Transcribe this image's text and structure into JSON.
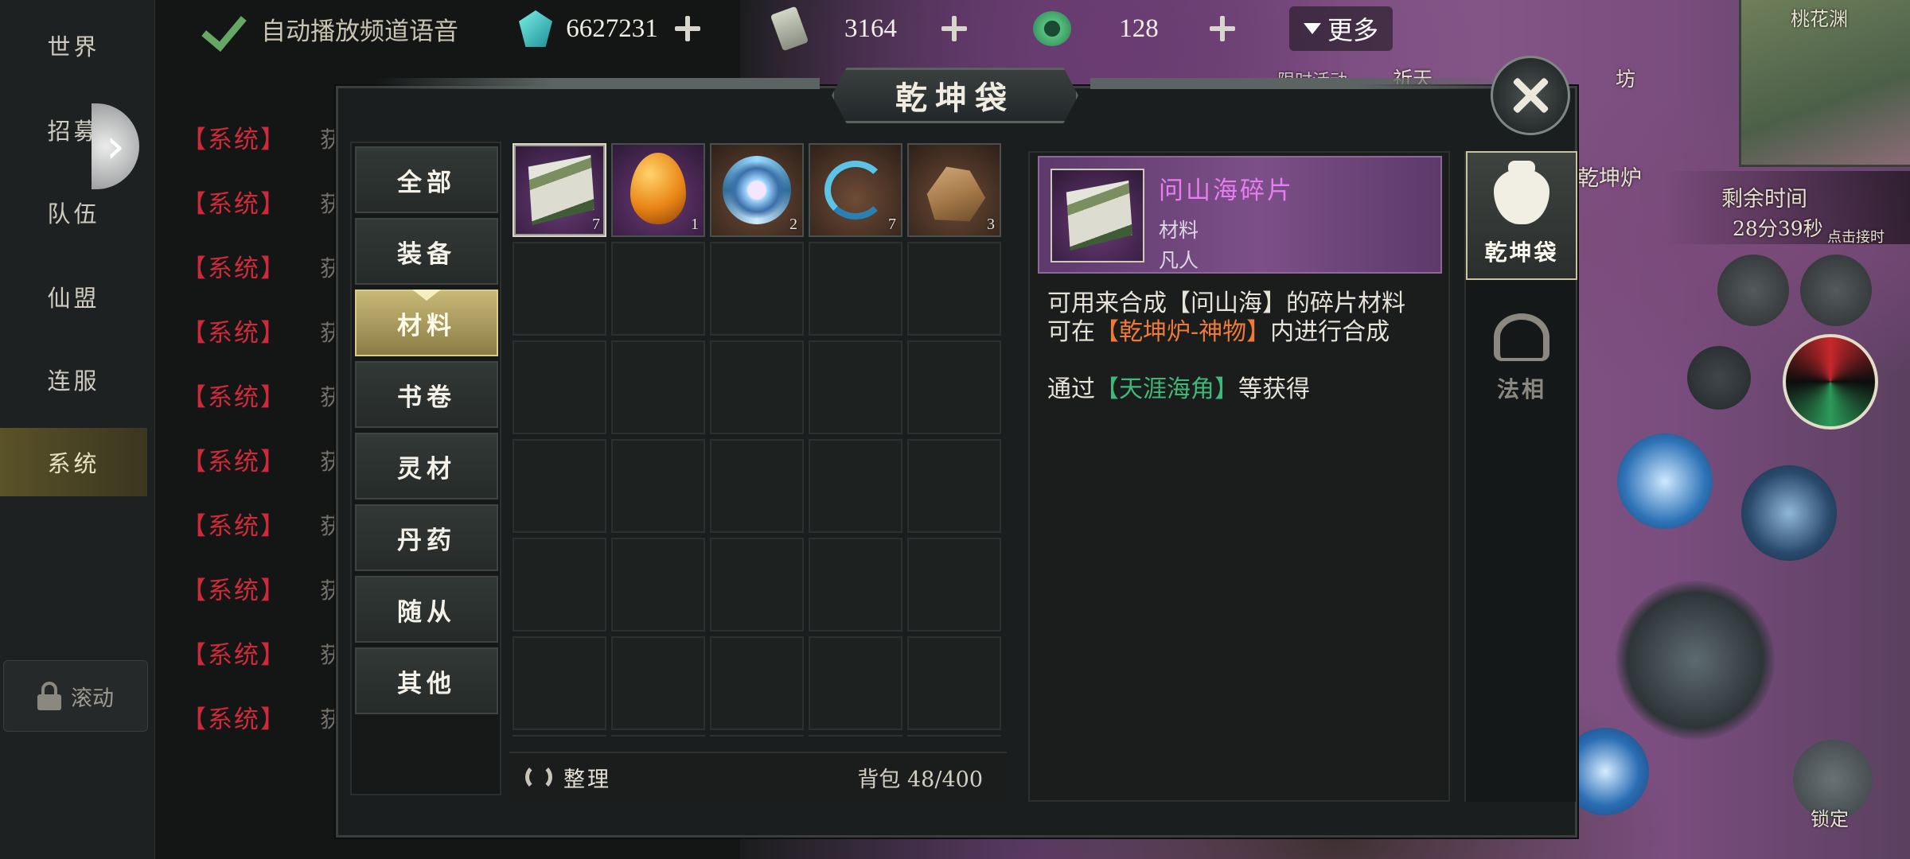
{
  "channels": {
    "tabs": [
      "世界",
      "招募",
      "队伍",
      "仙盟",
      "连服",
      "系统"
    ],
    "active": "系统",
    "scroll_lock_label": "滚动",
    "system_tag": "【系统】",
    "system_tag_count": 10,
    "message_prefix": "获"
  },
  "topbar": {
    "autoplay_label": "自动播放频道语音",
    "currencies": [
      {
        "icon": "spirit-stone-icon",
        "value": "6627231"
      },
      {
        "icon": "scroll-token-icon",
        "value": "3164"
      },
      {
        "icon": "jade-icon",
        "value": "128"
      }
    ],
    "more_label": "更多"
  },
  "hud": {
    "map_name": "桃花渊",
    "event_label": "限时活动",
    "pray_label": "祈天",
    "shop_label": "坊",
    "furnace_label": "乾坤炉",
    "remaining_time_label": "剩余时间",
    "remaining_time_value": "28分39秒",
    "click_hint": "点击接时",
    "lock_label": "锁定"
  },
  "bag": {
    "title": "乾坤袋",
    "categories": [
      "全部",
      "装备",
      "材料",
      "书卷",
      "灵材",
      "丹药",
      "随从",
      "其他"
    ],
    "active_category": "材料",
    "items": [
      {
        "name": "问山海碎片",
        "icon": "scroll-fragment-icon",
        "count": "7",
        "quality": "purple",
        "selected": true
      },
      {
        "name": "",
        "icon": "amber-egg-icon",
        "count": "1",
        "quality": "purple",
        "selected": false
      },
      {
        "name": "",
        "icon": "spirit-orb-icon",
        "count": "2",
        "quality": "brown",
        "selected": false
      },
      {
        "name": "",
        "icon": "water-swirl-icon",
        "count": "7",
        "quality": "brown",
        "selected": false
      },
      {
        "name": "",
        "icon": "ore-rock-icon",
        "count": "3",
        "quality": "brown",
        "selected": false
      }
    ],
    "sort_label": "整理",
    "capacity_label": "背包 48/400",
    "detail": {
      "name": "问山海碎片",
      "type": "材料",
      "rank": "凡人",
      "line1": "可用来合成【问山海】的碎片材料",
      "line2_prefix": "可在",
      "line2_highlight": "【乾坤炉-神物】",
      "line2_suffix": "内进行合成",
      "line3_prefix": "通过",
      "line3_highlight": "【天涯海角】",
      "line3_suffix": "等获得"
    },
    "side_tabs": [
      {
        "label": "乾坤袋",
        "icon": "bag-icon",
        "active": true
      },
      {
        "label": "法相",
        "icon": "faxiang-icon",
        "active": false
      }
    ]
  },
  "colors": {
    "system_tag": "#d02a3a",
    "active_category": "#c8b876",
    "item_name": "#e87cf0",
    "highlight_orange": "#ef7a38",
    "highlight_green": "#3fb879"
  }
}
